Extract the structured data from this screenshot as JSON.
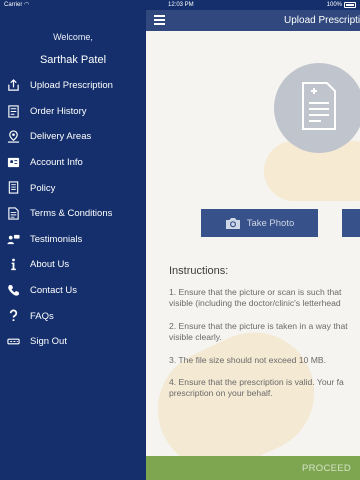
{
  "status_bar": {
    "carrier": "Carrier",
    "time": "12:03 PM",
    "battery": "100%"
  },
  "sidebar": {
    "welcome": "Welcome,",
    "user_name": "Sarthak Patel",
    "items": [
      {
        "label": "Upload Prescription",
        "icon": "upload-icon"
      },
      {
        "label": "Order History",
        "icon": "order-history-icon"
      },
      {
        "label": "Delivery Areas",
        "icon": "location-icon"
      },
      {
        "label": "Account Info",
        "icon": "account-icon"
      },
      {
        "label": "Policy",
        "icon": "policy-icon"
      },
      {
        "label": "Terms & Conditions",
        "icon": "terms-icon"
      },
      {
        "label": "Testimonials",
        "icon": "testimonials-icon"
      },
      {
        "label": "About Us",
        "icon": "info-icon"
      },
      {
        "label": "Contact Us",
        "icon": "phone-icon"
      },
      {
        "label": "FAQs",
        "icon": "question-icon"
      },
      {
        "label": "Sign Out",
        "icon": "sign-out-icon"
      }
    ]
  },
  "header": {
    "title": "Upload Prescription"
  },
  "main": {
    "take_photo": "Take Photo",
    "instructions_title": "Instructions:",
    "instructions": [
      "1. Ensure that the picture or scan is such that",
      "visible (including the doctor/clinic's letterhead",
      "2. Ensure that the picture is taken in a way that",
      "visible clearly.",
      "3. The file size should not exceed 10 MB.",
      "4. Ensure that the prescription is valid. Your fa",
      "prescription on your behalf."
    ],
    "proceed": "PROCEED"
  },
  "colors": {
    "primary": "#142f6b",
    "button": "#1c3a7a",
    "proceed": "#6d9a3a",
    "background": "#f4f3ee"
  }
}
